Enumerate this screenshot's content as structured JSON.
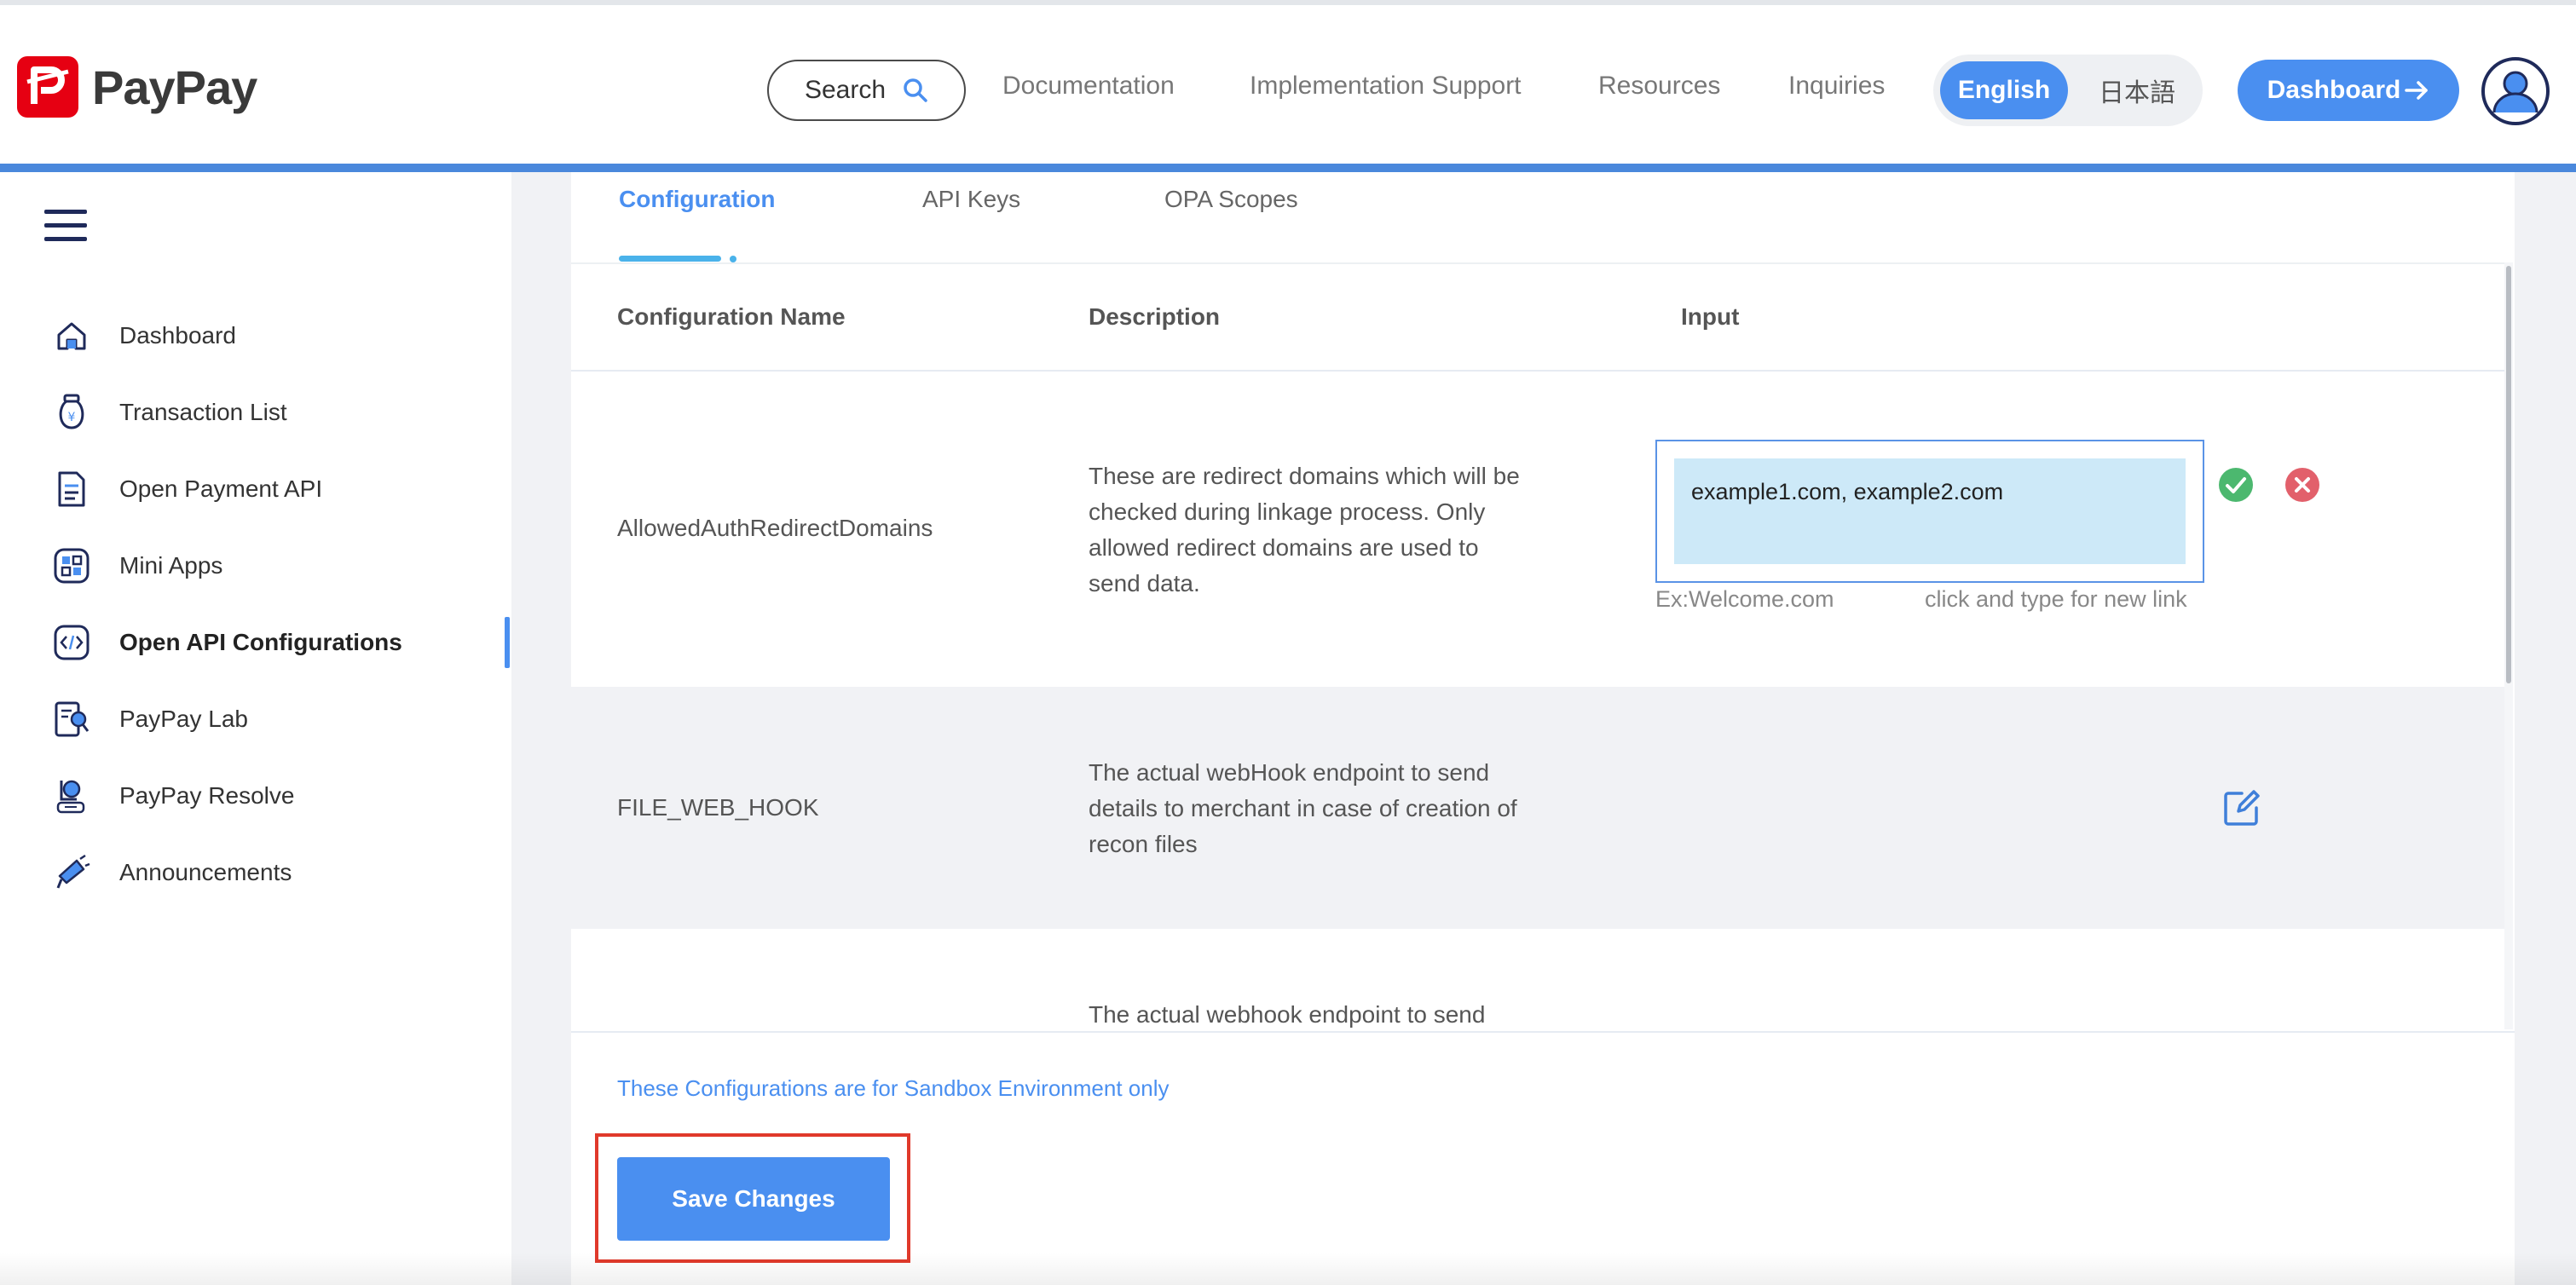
{
  "brand": {
    "name": "PayPay",
    "color": "#e60012"
  },
  "header": {
    "search_label": "Search",
    "nav": [
      "Documentation",
      "Implementation Support",
      "Resources",
      "Inquiries"
    ],
    "lang_en": "English",
    "lang_ja": "日本語",
    "dashboard_label": "Dashboard",
    "accent_color": "#4a8ff0"
  },
  "sidebar": {
    "items": [
      {
        "label": "Dashboard",
        "icon": "home-icon"
      },
      {
        "label": "Transaction List",
        "icon": "yen-bag-icon"
      },
      {
        "label": "Open Payment API",
        "icon": "document-icon"
      },
      {
        "label": "Mini Apps",
        "icon": "mini-apps-icon"
      },
      {
        "label": "Open API Configurations",
        "icon": "code-icon",
        "active": true
      },
      {
        "label": "PayPay Lab",
        "icon": "lab-icon"
      },
      {
        "label": "PayPay Resolve",
        "icon": "resolve-icon"
      },
      {
        "label": "Announcements",
        "icon": "megaphone-icon"
      }
    ]
  },
  "tabs": [
    {
      "label": "Configuration",
      "active": true
    },
    {
      "label": "API Keys"
    },
    {
      "label": "OPA Scopes"
    }
  ],
  "table": {
    "headers": [
      "Configuration Name",
      "Description",
      "Input"
    ],
    "rows": [
      {
        "name": "AllowedAuthRedirectDomains",
        "description": "These are redirect domains which will be checked during linkage process. Only allowed redirect domains are used to send data.",
        "input_value": "example1.com, example2.com",
        "hint_left": "Ex:Welcome.com",
        "hint_right": "click and type for new link"
      },
      {
        "name": "FILE_WEB_HOOK",
        "description": "The actual webHook endpoint to send details to merchant in case of creation of recon files"
      },
      {
        "name": "",
        "description": "The actual webhook endpoint to send"
      }
    ]
  },
  "footer": {
    "sandbox_note": "These Configurations are for Sandbox Environment only",
    "save_label": "Save Changes"
  }
}
